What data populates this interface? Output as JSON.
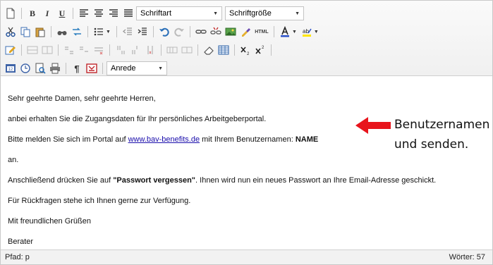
{
  "toolbar": {
    "font_select": {
      "value": "Schriftart"
    },
    "size_select": {
      "value": "Schriftgröße"
    },
    "salutation_select": {
      "value": "Anrede"
    },
    "html_button_label": "HTML"
  },
  "content": {
    "lines": [
      "Sehr geehrte Damen, sehr geehrte Herren,",
      "anbei erhalten Sie die Zugangsdaten für Ihr persönliches Arbeitgeberportal.",
      "Bitte melden Sie sich im Portal auf ",
      "www.bav-benefits.de",
      " mit Ihrem Benutzernamen: ",
      "NAME",
      "an.",
      "Anschließend drücken Sie auf ",
      "\"Passwort vergessen\"",
      ". Ihnen wird nun ein neues Passwort an Ihre Email-Adresse geschickt.",
      "Für Rückfragen stehe ich Ihnen gerne zur Verfügung.",
      "Mit freundlichen Grüßen",
      "Berater"
    ]
  },
  "annotation": {
    "line1": "Benutzernamen",
    "line2": "und senden.",
    "arrow_color": "#e8141c"
  },
  "statusbar": {
    "path": "Pfad: p",
    "words": "Wörter: 57"
  }
}
